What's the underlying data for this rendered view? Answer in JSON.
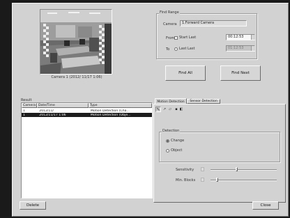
{
  "camera": {
    "caption": "Camera 1 (2012/ 11/17 1:06)"
  },
  "find_range": {
    "title": "Find Range",
    "camera_label": "Camera",
    "camera_value": "1.Forward Camera",
    "from_label": "From",
    "from_option": "Start Last",
    "from_value": "00:12:53",
    "to_label": "To",
    "to_option": "Last Last",
    "to_value": "01:12:53"
  },
  "buttons": {
    "find_all": "Find All",
    "find_next": "Find Next",
    "delete": "Delete",
    "close": "Close"
  },
  "result": {
    "title": "Result",
    "columns": [
      "Camera",
      "Date/Time",
      "Type"
    ],
    "rows": [
      {
        "camera": "1",
        "datetime": "2012/11/",
        "type": "Motion Detection (Cha...",
        "selected": false
      },
      {
        "camera": "1",
        "datetime": "2012/11/17 1:06",
        "type": "Motion Detection (Obje...",
        "selected": true
      }
    ]
  },
  "tabs": {
    "motion": "Motion Detection",
    "sensor": "Sensor Detection"
  },
  "detection": {
    "group_title": "Detection",
    "change_label": "Change",
    "object_label": "Object",
    "change_selected": true,
    "sensitivity_label": "Sensitivity",
    "sensitivity_level": 0.38,
    "min_blocks_label": "Min. Blocks",
    "min_blocks_level": 0.08
  },
  "icons": {
    "pen": "pen-icon",
    "select": "pointer-icon",
    "eraser": "eraser-icon",
    "fill": "fill-icon",
    "clear": "clear-icon"
  },
  "colors": {
    "selected_row_bg": "#1c1c1c",
    "selected_row_fg": "#ffffff"
  }
}
